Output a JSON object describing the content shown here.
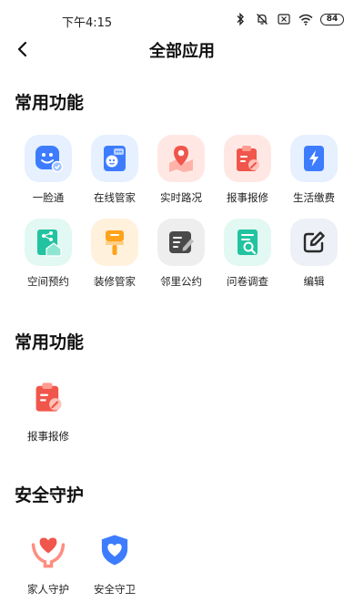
{
  "status": {
    "time": "下午4:15",
    "battery": "84"
  },
  "nav": {
    "title": "全部应用"
  },
  "sections": [
    {
      "title": "常用功能",
      "apps": [
        {
          "label": "一脸通",
          "icon": "face-id-icon",
          "bg": "#e6f0ff",
          "color": "#3d7cff"
        },
        {
          "label": "在线管家",
          "icon": "chat-robot-icon",
          "bg": "#e6f0ff",
          "color": "#3d7cff"
        },
        {
          "label": "实时路况",
          "icon": "map-pin-icon",
          "bg": "#ffe8e4",
          "color": "#f0564b"
        },
        {
          "label": "报事报修",
          "icon": "repair-clipboard-icon",
          "bg": "#ffe8e4",
          "color": "#f0564b"
        },
        {
          "label": "生活缴费",
          "icon": "lightning-icon",
          "bg": "#e6f0ff",
          "color": "#3d7cff"
        },
        {
          "label": "空间预约",
          "icon": "share-house-icon",
          "bg": "#e2f8f2",
          "color": "#22c3a0"
        },
        {
          "label": "装修管家",
          "icon": "paint-roller-icon",
          "bg": "#fff1dc",
          "color": "#ffa31a"
        },
        {
          "label": "邻里公约",
          "icon": "note-edit-icon",
          "bg": "#eeeeee",
          "color": "#4a4a4a"
        },
        {
          "label": "问卷调查",
          "icon": "survey-search-icon",
          "bg": "#e2f8f2",
          "color": "#22c3a0"
        },
        {
          "label": "编辑",
          "icon": "edit-icon",
          "bg": "#edf0f7",
          "color": "#2a2a2a"
        }
      ]
    },
    {
      "title": "常用功能",
      "apps": [
        {
          "label": "报事报修",
          "icon": "repair-clipboard-icon",
          "bg": "transparent",
          "color": "#f0564b"
        }
      ]
    },
    {
      "title": "安全守护",
      "apps": [
        {
          "label": "家人守护",
          "icon": "heart-hands-icon",
          "bg": "transparent",
          "color": "#f0564b"
        },
        {
          "label": "安全守卫",
          "icon": "shield-heart-icon",
          "bg": "transparent",
          "color": "#3d7cff"
        }
      ]
    }
  ]
}
